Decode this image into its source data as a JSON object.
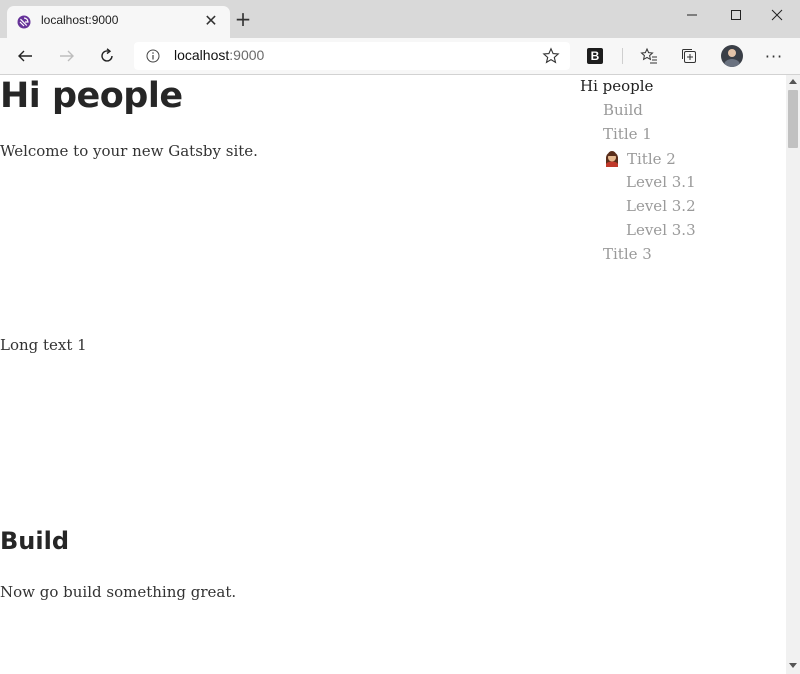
{
  "browser": {
    "tab": {
      "title": "localhost:9000",
      "close_glyph": "✕",
      "favicon": "gatsby-icon"
    },
    "new_tab_glyph": "+",
    "window_controls": [
      "minimize-icon",
      "maximize-icon",
      "close-icon"
    ],
    "address": {
      "host": "localhost",
      "port": ":9000"
    },
    "toolbar_icons": [
      "back-icon",
      "forward-icon",
      "refresh-icon",
      "info-icon",
      "favorite-star-icon",
      "bold-extension-icon",
      "favorites-icon",
      "collections-icon",
      "profile-avatar",
      "more-icon"
    ],
    "extension_letter": "B",
    "more_glyph": "···"
  },
  "page": {
    "heading": "Hi people",
    "intro": "Welcome to your new Gatsby site.",
    "long_text": "Long text 1",
    "section_heading": "Build",
    "section_text": "Now go build something great."
  },
  "toc": {
    "items": [
      {
        "label": "Hi people",
        "level": 0,
        "active": true
      },
      {
        "label": "Build",
        "level": 1
      },
      {
        "label": "Title 1",
        "level": 1
      },
      {
        "label": "Title 2",
        "level": 1,
        "emoji": "woman-emoji"
      },
      {
        "label": "Level 3.1",
        "level": 2
      },
      {
        "label": "Level 3.2",
        "level": 2
      },
      {
        "label": "Level 3.3",
        "level": 2
      },
      {
        "label": "Title 3",
        "level": 1
      }
    ]
  },
  "colors": {
    "accent": "#663399",
    "text": "#262626",
    "toc_inactive": "#9a9a9a"
  }
}
